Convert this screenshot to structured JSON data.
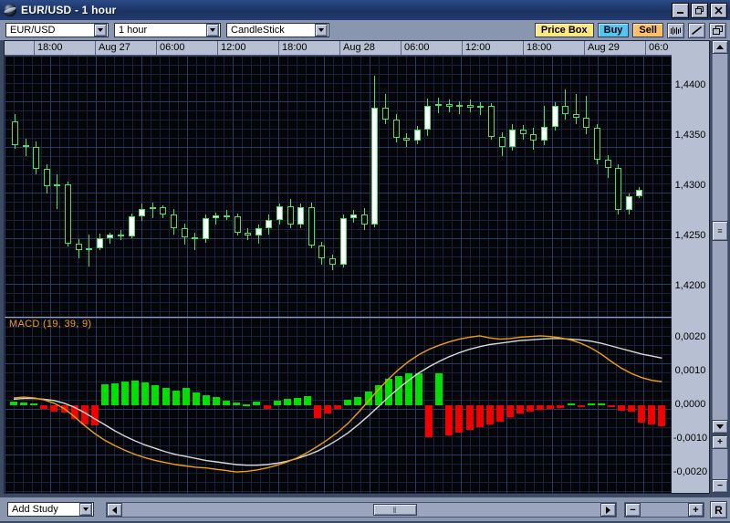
{
  "window": {
    "title": "EUR/USD - 1 hour",
    "icon": "globe-icon",
    "minimize": "_",
    "restore": "❐",
    "close": "✕"
  },
  "toolbar": {
    "symbol": {
      "value": "EUR/USD",
      "placeholder": "Symbol"
    },
    "interval": {
      "value": "1 hour",
      "placeholder": "Interval"
    },
    "charttype": {
      "value": "CandleStick",
      "placeholder": "Chart type"
    },
    "price_box_label": "Price Box",
    "buy_label": "Buy",
    "sell_label": "Sell",
    "price_box_color": "#ffe97f",
    "buy_color": "#54c4f4",
    "sell_color": "#ffc06a",
    "bar_chart_icon": "bar-chart-icon",
    "trendline_icon": "trendline-icon",
    "window_icon": "restore-window-icon"
  },
  "bottombar": {
    "add_study": {
      "value": "Add Study"
    },
    "scroll_left": "◄",
    "scroll_right": "►",
    "thumb_grip": "‖",
    "zoom_out": "−",
    "zoom_in": "+",
    "reset_label": "R"
  },
  "rightcolumn": {
    "scroll_up": "▲",
    "scroll_down": "▼",
    "thumb_grip": "≡",
    "zoom_in": "+",
    "zoom_out": "−"
  },
  "chart_data": {
    "type": "candlestick",
    "title": "EUR/USD - 1 hour",
    "symbol": "EUR/USD",
    "interval": "1 hour",
    "style": "CandleStick",
    "grid": true,
    "legend": "none",
    "background": "#040509",
    "gridcolor": "#18203a",
    "up_color": "#ffffff",
    "down_color": "#050608",
    "outline_color": "#49e06a",
    "xlabel": "",
    "ylabel": "",
    "ylim": [
      1.417,
      1.443
    ],
    "ytick_labels": [
      "1,4400",
      "1,4350",
      "1,4300",
      "1,4250",
      "1,4200"
    ],
    "ytick_values": [
      1.44,
      1.435,
      1.43,
      1.425,
      1.42
    ],
    "xtick_labels": [
      "18:00",
      "Aug 27",
      "06:00",
      "12:00",
      "18:00",
      "Aug 28",
      "06:00",
      "12:00",
      "18:00",
      "Aug 29",
      "06:0"
    ],
    "ohlc": [
      {
        "o": 1.4365,
        "h": 1.4372,
        "l": 1.4337,
        "c": 1.4341
      },
      {
        "o": 1.4341,
        "h": 1.4347,
        "l": 1.433,
        "c": 1.4339
      },
      {
        "o": 1.4339,
        "h": 1.4345,
        "l": 1.4312,
        "c": 1.4317
      },
      {
        "o": 1.4317,
        "h": 1.4322,
        "l": 1.4293,
        "c": 1.43
      },
      {
        "o": 1.43,
        "h": 1.4312,
        "l": 1.4277,
        "c": 1.4302
      },
      {
        "o": 1.4302,
        "h": 1.4305,
        "l": 1.424,
        "c": 1.4243
      },
      {
        "o": 1.4243,
        "h": 1.4247,
        "l": 1.4228,
        "c": 1.4236
      },
      {
        "o": 1.4236,
        "h": 1.4252,
        "l": 1.422,
        "c": 1.4238
      },
      {
        "o": 1.4238,
        "h": 1.4253,
        "l": 1.4236,
        "c": 1.4248
      },
      {
        "o": 1.4248,
        "h": 1.4254,
        "l": 1.4243,
        "c": 1.4252
      },
      {
        "o": 1.4252,
        "h": 1.4256,
        "l": 1.4246,
        "c": 1.425
      },
      {
        "o": 1.425,
        "h": 1.4273,
        "l": 1.4248,
        "c": 1.427
      },
      {
        "o": 1.427,
        "h": 1.4283,
        "l": 1.4265,
        "c": 1.4277
      },
      {
        "o": 1.4277,
        "h": 1.4284,
        "l": 1.4268,
        "c": 1.4279
      },
      {
        "o": 1.4279,
        "h": 1.4281,
        "l": 1.4268,
        "c": 1.4272
      },
      {
        "o": 1.4272,
        "h": 1.4277,
        "l": 1.4252,
        "c": 1.4258
      },
      {
        "o": 1.4258,
        "h": 1.4263,
        "l": 1.4242,
        "c": 1.4249
      },
      {
        "o": 1.4249,
        "h": 1.4254,
        "l": 1.4236,
        "c": 1.4247
      },
      {
        "o": 1.4247,
        "h": 1.4272,
        "l": 1.4244,
        "c": 1.4268
      },
      {
        "o": 1.4268,
        "h": 1.4274,
        "l": 1.4262,
        "c": 1.4271
      },
      {
        "o": 1.4271,
        "h": 1.4276,
        "l": 1.4266,
        "c": 1.427
      },
      {
        "o": 1.427,
        "h": 1.4273,
        "l": 1.4251,
        "c": 1.4254
      },
      {
        "o": 1.4254,
        "h": 1.4258,
        "l": 1.4246,
        "c": 1.4251
      },
      {
        "o": 1.4251,
        "h": 1.4262,
        "l": 1.4243,
        "c": 1.4258
      },
      {
        "o": 1.4258,
        "h": 1.4272,
        "l": 1.4252,
        "c": 1.4266
      },
      {
        "o": 1.4266,
        "h": 1.4283,
        "l": 1.4262,
        "c": 1.428
      },
      {
        "o": 1.428,
        "h": 1.4287,
        "l": 1.4258,
        "c": 1.4262
      },
      {
        "o": 1.4262,
        "h": 1.4283,
        "l": 1.4258,
        "c": 1.4279
      },
      {
        "o": 1.4279,
        "h": 1.4284,
        "l": 1.4238,
        "c": 1.4241
      },
      {
        "o": 1.4241,
        "h": 1.4245,
        "l": 1.4222,
        "c": 1.4228
      },
      {
        "o": 1.4228,
        "h": 1.4232,
        "l": 1.4216,
        "c": 1.4222
      },
      {
        "o": 1.4222,
        "h": 1.4272,
        "l": 1.4219,
        "c": 1.4268
      },
      {
        "o": 1.4268,
        "h": 1.4276,
        "l": 1.4264,
        "c": 1.4272
      },
      {
        "o": 1.4272,
        "h": 1.4278,
        "l": 1.4256,
        "c": 1.4262
      },
      {
        "o": 1.4262,
        "h": 1.441,
        "l": 1.4259,
        "c": 1.4378
      },
      {
        "o": 1.4378,
        "h": 1.4392,
        "l": 1.4362,
        "c": 1.4366
      },
      {
        "o": 1.4366,
        "h": 1.4372,
        "l": 1.4344,
        "c": 1.4348
      },
      {
        "o": 1.4348,
        "h": 1.4353,
        "l": 1.4339,
        "c": 1.4345
      },
      {
        "o": 1.4345,
        "h": 1.436,
        "l": 1.4342,
        "c": 1.4356
      },
      {
        "o": 1.4356,
        "h": 1.4387,
        "l": 1.435,
        "c": 1.438
      },
      {
        "o": 1.438,
        "h": 1.4388,
        "l": 1.4373,
        "c": 1.4382
      },
      {
        "o": 1.4382,
        "h": 1.4386,
        "l": 1.4374,
        "c": 1.4379
      },
      {
        "o": 1.4379,
        "h": 1.4385,
        "l": 1.4372,
        "c": 1.4381
      },
      {
        "o": 1.4381,
        "h": 1.4386,
        "l": 1.4374,
        "c": 1.4378
      },
      {
        "o": 1.4378,
        "h": 1.4384,
        "l": 1.4371,
        "c": 1.438
      },
      {
        "o": 1.438,
        "h": 1.4383,
        "l": 1.4346,
        "c": 1.4349
      },
      {
        "o": 1.4349,
        "h": 1.4354,
        "l": 1.433,
        "c": 1.4339
      },
      {
        "o": 1.4339,
        "h": 1.4362,
        "l": 1.4335,
        "c": 1.4356
      },
      {
        "o": 1.4356,
        "h": 1.4361,
        "l": 1.4346,
        "c": 1.4352
      },
      {
        "o": 1.4352,
        "h": 1.4358,
        "l": 1.4336,
        "c": 1.4345
      },
      {
        "o": 1.4345,
        "h": 1.438,
        "l": 1.4341,
        "c": 1.4359
      },
      {
        "o": 1.4359,
        "h": 1.4384,
        "l": 1.4355,
        "c": 1.438
      },
      {
        "o": 1.438,
        "h": 1.4396,
        "l": 1.4366,
        "c": 1.4372
      },
      {
        "o": 1.4372,
        "h": 1.4392,
        "l": 1.4362,
        "c": 1.4368
      },
      {
        "o": 1.4368,
        "h": 1.439,
        "l": 1.4352,
        "c": 1.4358
      },
      {
        "o": 1.4358,
        "h": 1.4362,
        "l": 1.4322,
        "c": 1.4326
      },
      {
        "o": 1.4326,
        "h": 1.4331,
        "l": 1.4308,
        "c": 1.4318
      },
      {
        "o": 1.4318,
        "h": 1.4322,
        "l": 1.4272,
        "c": 1.4276
      },
      {
        "o": 1.4276,
        "h": 1.4293,
        "l": 1.4272,
        "c": 1.429
      },
      {
        "o": 1.429,
        "h": 1.4299,
        "l": 1.4288,
        "c": 1.4296
      }
    ]
  },
  "macd_data": {
    "type": "macd",
    "label": "MACD (19, 39, 9)",
    "label_color": "#f0a010",
    "params": [
      19,
      39,
      9
    ],
    "macd_line_color": "#f0a010",
    "signal_line_color": "#d8d8d8",
    "hist_pos_color": "#00e000",
    "hist_neg_color": "#f20000",
    "ytick_labels": [
      "0,0020",
      "0,0010",
      "0,0000",
      "-0,0010",
      "-0,0020"
    ],
    "ytick_values": [
      0.002,
      0.001,
      0.0,
      -0.001,
      -0.002
    ],
    "ylim": [
      -0.0026,
      0.0026
    ],
    "histogram": [
      0.0001,
      8e-05,
      6e-05,
      -0.00012,
      -0.00018,
      -0.00022,
      -0.0004,
      -0.00058,
      -0.0006,
      0.00062,
      0.00066,
      0.0007,
      0.00074,
      0.00068,
      0.0006,
      0.00052,
      0.00044,
      0.00052,
      0.00038,
      0.0003,
      0.00024,
      0.00014,
      8e-05,
      2e-05,
      0.0001,
      -0.0001,
      0.00014,
      0.00018,
      0.00022,
      0.00026,
      -0.00038,
      -0.00024,
      -0.00012,
      0.00016,
      0.00024,
      0.0004,
      0.0006,
      0.00078,
      0.00086,
      0.00094,
      0.00096,
      -0.00094,
      0.00096,
      -0.0009,
      -0.00082,
      -0.00074,
      -0.00066,
      -0.00056,
      -0.00048,
      -0.00034,
      -0.00024,
      -0.00018,
      -0.00014,
      -0.0001,
      -8e-05,
      6e-05,
      -5e-05,
      6e-05,
      6e-05,
      -4e-05,
      -0.00016,
      -0.0002,
      -0.00052,
      -0.00058,
      -0.00062
    ],
    "macd_line": [
      0.00022,
      0.00024,
      0.00022,
      0.00016,
      6e-05,
      -0.0001,
      -0.00034,
      -0.0006,
      -0.00084,
      -0.00104,
      -0.0012,
      -0.00134,
      -0.00146,
      -0.00156,
      -0.00164,
      -0.0017,
      -0.00176,
      -0.0018,
      -0.00184,
      -0.00186,
      -0.0019,
      -0.00194,
      -0.00198,
      -0.00196,
      -0.00192,
      -0.00186,
      -0.00178,
      -0.00168,
      -0.00156,
      -0.0014,
      -0.00122,
      -0.00102,
      -0.0008,
      -0.00054,
      -0.00022,
      0.00012,
      0.00046,
      0.00078,
      0.00106,
      0.0013,
      0.0015,
      0.00166,
      0.00178,
      0.00188,
      0.00196,
      0.00202,
      0.00206,
      0.002,
      0.00196,
      0.00198,
      0.00202,
      0.00204,
      0.00206,
      0.00204,
      0.002,
      0.00194,
      0.00184,
      0.0017,
      0.00152,
      0.0013,
      0.0011,
      0.00094,
      0.00082,
      0.00074,
      0.0007
    ],
    "signal_line": [
      0.00018,
      0.0002,
      0.0002,
      0.00018,
      0.00014,
      6e-05,
      -6e-05,
      -0.00022,
      -0.0004,
      -0.00058,
      -0.00076,
      -0.00092,
      -0.00106,
      -0.00118,
      -0.00128,
      -0.00138,
      -0.00146,
      -0.00152,
      -0.00158,
      -0.00164,
      -0.00168,
      -0.00172,
      -0.00176,
      -0.00178,
      -0.00178,
      -0.00176,
      -0.00172,
      -0.00166,
      -0.00158,
      -0.00148,
      -0.00136,
      -0.0012,
      -0.00102,
      -0.00082,
      -0.00058,
      -0.00032,
      -4e-05,
      0.00024,
      0.0005,
      0.00074,
      0.00096,
      0.00114,
      0.0013,
      0.00144,
      0.00156,
      0.00166,
      0.00174,
      0.0018,
      0.00184,
      0.00188,
      0.00192,
      0.00194,
      0.00196,
      0.00198,
      0.00198,
      0.00196,
      0.00194,
      0.0019,
      0.00184,
      0.00176,
      0.00168,
      0.0016,
      0.00152,
      0.00146,
      0.0014
    ]
  }
}
